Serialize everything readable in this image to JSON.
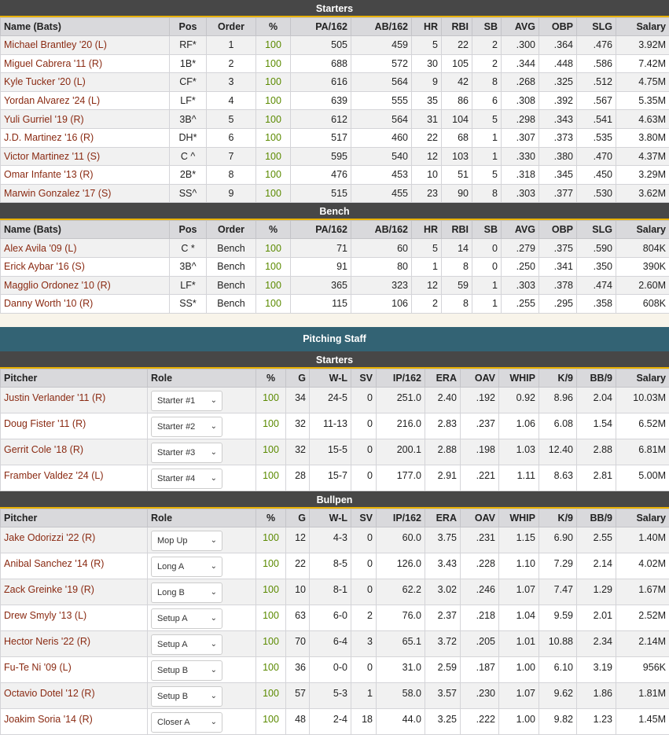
{
  "batting": {
    "starters_title": "Starters",
    "bench_title": "Bench",
    "headers": [
      "Name (Bats)",
      "Pos",
      "Order",
      "%",
      "PA/162",
      "AB/162",
      "HR",
      "RBI",
      "SB",
      "AVG",
      "OBP",
      "SLG",
      "Salary"
    ],
    "starters": [
      [
        "Michael Brantley '20 (L)",
        "RF*",
        "1",
        "100",
        "505",
        "459",
        "5",
        "22",
        "2",
        ".300",
        ".364",
        ".476",
        "3.92M"
      ],
      [
        "Miguel Cabrera '11 (R)",
        "1B*",
        "2",
        "100",
        "688",
        "572",
        "30",
        "105",
        "2",
        ".344",
        ".448",
        ".586",
        "7.42M"
      ],
      [
        "Kyle Tucker '20 (L)",
        "CF*",
        "3",
        "100",
        "616",
        "564",
        "9",
        "42",
        "8",
        ".268",
        ".325",
        ".512",
        "4.75M"
      ],
      [
        "Yordan Alvarez '24 (L)",
        "LF*",
        "4",
        "100",
        "639",
        "555",
        "35",
        "86",
        "6",
        ".308",
        ".392",
        ".567",
        "5.35M"
      ],
      [
        "Yuli Gurriel '19 (R)",
        "3B^",
        "5",
        "100",
        "612",
        "564",
        "31",
        "104",
        "5",
        ".298",
        ".343",
        ".541",
        "4.63M"
      ],
      [
        "J.D. Martinez '16 (R)",
        "DH*",
        "6",
        "100",
        "517",
        "460",
        "22",
        "68",
        "1",
        ".307",
        ".373",
        ".535",
        "3.80M"
      ],
      [
        "Victor Martinez '11 (S)",
        "C ^",
        "7",
        "100",
        "595",
        "540",
        "12",
        "103",
        "1",
        ".330",
        ".380",
        ".470",
        "4.37M"
      ],
      [
        "Omar Infante '13 (R)",
        "2B*",
        "8",
        "100",
        "476",
        "453",
        "10",
        "51",
        "5",
        ".318",
        ".345",
        ".450",
        "3.29M"
      ],
      [
        "Marwin Gonzalez '17 (S)",
        "SS^",
        "9",
        "100",
        "515",
        "455",
        "23",
        "90",
        "8",
        ".303",
        ".377",
        ".530",
        "3.62M"
      ]
    ],
    "bench": [
      [
        "Alex Avila '09 (L)",
        "C *",
        "Bench",
        "100",
        "71",
        "60",
        "5",
        "14",
        "0",
        ".279",
        ".375",
        ".590",
        "804K"
      ],
      [
        "Erick Aybar '16 (S)",
        "3B^",
        "Bench",
        "100",
        "91",
        "80",
        "1",
        "8",
        "0",
        ".250",
        ".341",
        ".350",
        "390K"
      ],
      [
        "Magglio Ordonez '10 (R)",
        "LF*",
        "Bench",
        "100",
        "365",
        "323",
        "12",
        "59",
        "1",
        ".303",
        ".378",
        ".474",
        "2.60M"
      ],
      [
        "Danny Worth '10 (R)",
        "SS*",
        "Bench",
        "100",
        "115",
        "106",
        "2",
        "8",
        "1",
        ".255",
        ".295",
        ".358",
        "608K"
      ]
    ]
  },
  "pitching": {
    "title": "Pitching Staff",
    "starters_title": "Starters",
    "bullpen_title": "Bullpen",
    "headers": [
      "Pitcher",
      "Role",
      "%",
      "G",
      "W-L",
      "SV",
      "IP/162",
      "ERA",
      "OAV",
      "WHIP",
      "K/9",
      "BB/9",
      "Salary"
    ],
    "starters": [
      [
        "Justin Verlander '11 (R)",
        "Starter #1",
        "100",
        "34",
        "24-5",
        "0",
        "251.0",
        "2.40",
        ".192",
        "0.92",
        "8.96",
        "2.04",
        "10.03M"
      ],
      [
        "Doug Fister '11 (R)",
        "Starter #2",
        "100",
        "32",
        "11-13",
        "0",
        "216.0",
        "2.83",
        ".237",
        "1.06",
        "6.08",
        "1.54",
        "6.52M"
      ],
      [
        "Gerrit Cole '18 (R)",
        "Starter #3",
        "100",
        "32",
        "15-5",
        "0",
        "200.1",
        "2.88",
        ".198",
        "1.03",
        "12.40",
        "2.88",
        "6.81M"
      ],
      [
        "Framber Valdez '24 (L)",
        "Starter #4",
        "100",
        "28",
        "15-7",
        "0",
        "177.0",
        "2.91",
        ".221",
        "1.11",
        "8.63",
        "2.81",
        "5.00M"
      ]
    ],
    "bullpen": [
      [
        "Jake Odorizzi '22 (R)",
        "Mop Up",
        "100",
        "12",
        "4-3",
        "0",
        "60.0",
        "3.75",
        ".231",
        "1.15",
        "6.90",
        "2.55",
        "1.40M"
      ],
      [
        "Anibal Sanchez '14 (R)",
        "Long A",
        "100",
        "22",
        "8-5",
        "0",
        "126.0",
        "3.43",
        ".228",
        "1.10",
        "7.29",
        "2.14",
        "4.02M"
      ],
      [
        "Zack Greinke '19 (R)",
        "Long B",
        "100",
        "10",
        "8-1",
        "0",
        "62.2",
        "3.02",
        ".246",
        "1.07",
        "7.47",
        "1.29",
        "1.67M"
      ],
      [
        "Drew Smyly '13 (L)",
        "Setup A",
        "100",
        "63",
        "6-0",
        "2",
        "76.0",
        "2.37",
        ".218",
        "1.04",
        "9.59",
        "2.01",
        "2.52M"
      ],
      [
        "Hector Neris '22 (R)",
        "Setup A",
        "100",
        "70",
        "6-4",
        "3",
        "65.1",
        "3.72",
        ".205",
        "1.01",
        "10.88",
        "2.34",
        "2.14M"
      ],
      [
        "Fu-Te Ni '09 (L)",
        "Setup B",
        "100",
        "36",
        "0-0",
        "0",
        "31.0",
        "2.59",
        ".187",
        "1.00",
        "6.10",
        "3.19",
        "956K"
      ],
      [
        "Octavio Dotel '12 (R)",
        "Setup B",
        "100",
        "57",
        "5-3",
        "1",
        "58.0",
        "3.57",
        ".230",
        "1.07",
        "9.62",
        "1.86",
        "1.81M"
      ],
      [
        "Joakim Soria '14 (R)",
        "Closer A",
        "100",
        "48",
        "2-4",
        "18",
        "44.0",
        "3.25",
        ".222",
        "1.00",
        "9.82",
        "1.23",
        "1.45M"
      ]
    ]
  }
}
